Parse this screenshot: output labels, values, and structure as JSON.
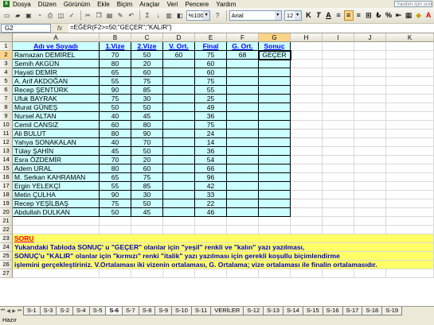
{
  "app": {
    "help_placeholder": "Yardım için soru"
  },
  "menu": [
    "Dosya",
    "Düzen",
    "Görünüm",
    "Ekle",
    "Biçim",
    "Araçlar",
    "Veri",
    "Pencere",
    "Yardım"
  ],
  "toolbar": {
    "zoom": "%100",
    "font": "Arial",
    "font_size": "12",
    "bold": "K",
    "italic": "T",
    "underline": "A"
  },
  "formula_bar": {
    "name_box": "G2",
    "fx_label": "fx",
    "formula": "=EĞER(F2>=50;\"GEÇER\";\"KALIR\")"
  },
  "columns": [
    "A",
    "B",
    "C",
    "D",
    "E",
    "F",
    "G",
    "H",
    "I",
    "J",
    "K"
  ],
  "rows": [
    "1",
    "2",
    "3",
    "4",
    "5",
    "6",
    "7",
    "8",
    "9",
    "10",
    "11",
    "12",
    "13",
    "14",
    "15",
    "16",
    "17",
    "18",
    "19",
    "20",
    "21",
    "22",
    "23",
    "24",
    "25",
    "26",
    "27"
  ],
  "headers": [
    "Adı ve Soyadı",
    "1.Vize",
    "2.Vize",
    "V. Ort.",
    "Final",
    "G. Ort.",
    "Sonuç"
  ],
  "students": [
    [
      "Ramazan DEMİREL",
      "70",
      "50",
      "60",
      "75",
      "68",
      "GEÇER"
    ],
    [
      "Semih AKGÜN",
      "80",
      "20",
      "",
      "60",
      "",
      ""
    ],
    [
      "Hayati DEMİR",
      "65",
      "60",
      "",
      "60",
      "",
      ""
    ],
    [
      "A. Arif AKDOĞAN",
      "55",
      "75",
      "",
      "75",
      "",
      ""
    ],
    [
      "Recep ŞENTÜRK",
      "90",
      "85",
      "",
      "55",
      "",
      ""
    ],
    [
      "Ufuk BAYRAK",
      "75",
      "30",
      "",
      "25",
      "",
      ""
    ],
    [
      "Murat GÜNEŞ",
      "50",
      "50",
      "",
      "49",
      "",
      ""
    ],
    [
      "Nursel ALTAN",
      "40",
      "45",
      "",
      "36",
      "",
      ""
    ],
    [
      "Cemil CANSIZ",
      "60",
      "80",
      "",
      "75",
      "",
      ""
    ],
    [
      "Ali BULUT",
      "80",
      "90",
      "",
      "24",
      "",
      ""
    ],
    [
      "Yahya SONAKALAN",
      "40",
      "70",
      "",
      "14",
      "",
      ""
    ],
    [
      "Tülay ŞAHİN",
      "45",
      "50",
      "",
      "36",
      "",
      ""
    ],
    [
      "Esra ÖZDEMİR",
      "70",
      "20",
      "",
      "54",
      "",
      ""
    ],
    [
      "Adem URAL",
      "80",
      "60",
      "",
      "66",
      "",
      ""
    ],
    [
      "M. Serkan KAHRAMAN",
      "65",
      "75",
      "",
      "96",
      "",
      ""
    ],
    [
      "Ergin YELEKÇİ",
      "55",
      "85",
      "",
      "42",
      "",
      ""
    ],
    [
      "Metin ÇULHA",
      "90",
      "30",
      "",
      "33",
      "",
      ""
    ],
    [
      "Recep YEŞİLBAŞ",
      "75",
      "50",
      "",
      "22",
      "",
      ""
    ],
    [
      "Abdullah DULKAN",
      "50",
      "45",
      "",
      "46",
      "",
      ""
    ]
  ],
  "question": {
    "title": "SORU",
    "line1": "Yukarıdaki Tabloda SONUÇ' u \"GEÇER\" olanlar için \"yeşil\" renkli ve \"kalın\" yazı yazılması,",
    "line2": "SONUÇ'u \"KALIR\" olanlar için \"kırmızı\" renki \"italik\" yazı yazılması için gerekli koşullu biçimlendirme",
    "line3": "işlemini gerçekleştiriniz. V.Ortalaması iki vizenin ortalaması, G. Ortalama; vize ortalaması ile finalin ortalamasıdır."
  },
  "sheets": [
    "S-1",
    "S-3",
    "S-2",
    "S-4",
    "S-5",
    "S-6",
    "S-7",
    "S-8",
    "S-9",
    "S-10",
    "S-11",
    "VERİLER",
    "S-12",
    "S-13",
    "S-14",
    "S-15",
    "S-16",
    "S-17",
    "S-18",
    "S-19"
  ],
  "active_sheet": "S-6",
  "status": "Hazır",
  "colors": {
    "table_fill": "#ccffff",
    "question_fill": "#ffff66",
    "header_text": "#0000ff"
  }
}
